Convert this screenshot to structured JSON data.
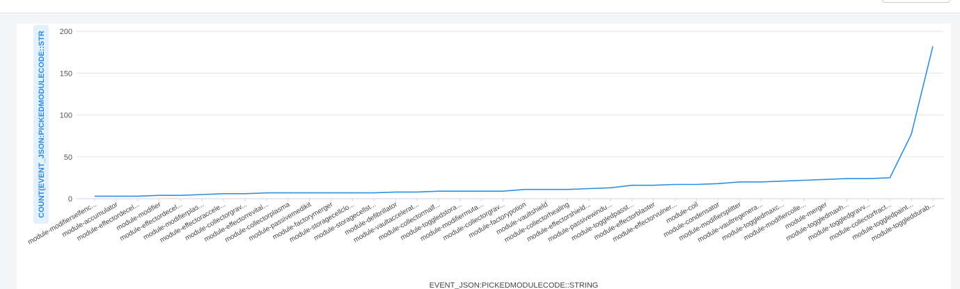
{
  "chart_data": {
    "type": "line",
    "xlabel": "EVENT_JSON:PICKEDMODULECODE::STRING",
    "ylabel": "COUNT(EVENT_JSON:PICKEDMODULECODE::STR",
    "ylim": [
      0,
      200
    ],
    "yticks": [
      0,
      50,
      100,
      150,
      200
    ],
    "grid": true,
    "categories": [
      "module-modifierselfenc...",
      "module-accumulator",
      "module-effectordecel...",
      "module-modifier",
      "module-effectordecel...",
      "module-modifierplas...",
      "module-effectoraccele...",
      "module-collectorgrav...",
      "module-effectorrevital...",
      "module-collectorplasma",
      "module-passivemedikit",
      "module-factorymerger",
      "module-storagecellclo...",
      "module-storagecellst...",
      "module-defibrillator",
      "module-vaultaccelerat...",
      "module-collectormalf...",
      "module-toggledstora...",
      "module-modifiermuta...",
      "module-collectorgrav...",
      "module-factorypotion",
      "module-vaultshield",
      "module-collectorhealing",
      "module-effectorshield...",
      "module-passivewindu...",
      "module-toggledpasst...",
      "module-effectorblaster",
      "module-effectorvulner...",
      "module-coil",
      "module-condensator",
      "module-modifiersplitter",
      "module-vaultregenera...",
      "module-toggledmaxc...",
      "module-modifiercolle...",
      "module-merger",
      "module-toggledmaxh...",
      "module-toggledgravv...",
      "module-collectorfract...",
      "module-toggledpaint...",
      "module-toggleddurab..."
    ],
    "values": [
      3,
      3,
      3,
      4,
      4,
      5,
      6,
      6,
      7,
      7,
      7,
      7,
      7,
      7,
      8,
      8,
      9,
      9,
      9,
      9,
      11,
      11,
      11,
      12,
      13,
      16,
      16,
      17,
      17,
      18,
      20,
      20,
      21,
      22,
      23,
      24,
      24,
      25,
      77,
      182
    ],
    "colors": {
      "series": "#2d8fe0",
      "grid": "#e6e6e6",
      "axis": "#cfd6e0"
    }
  }
}
